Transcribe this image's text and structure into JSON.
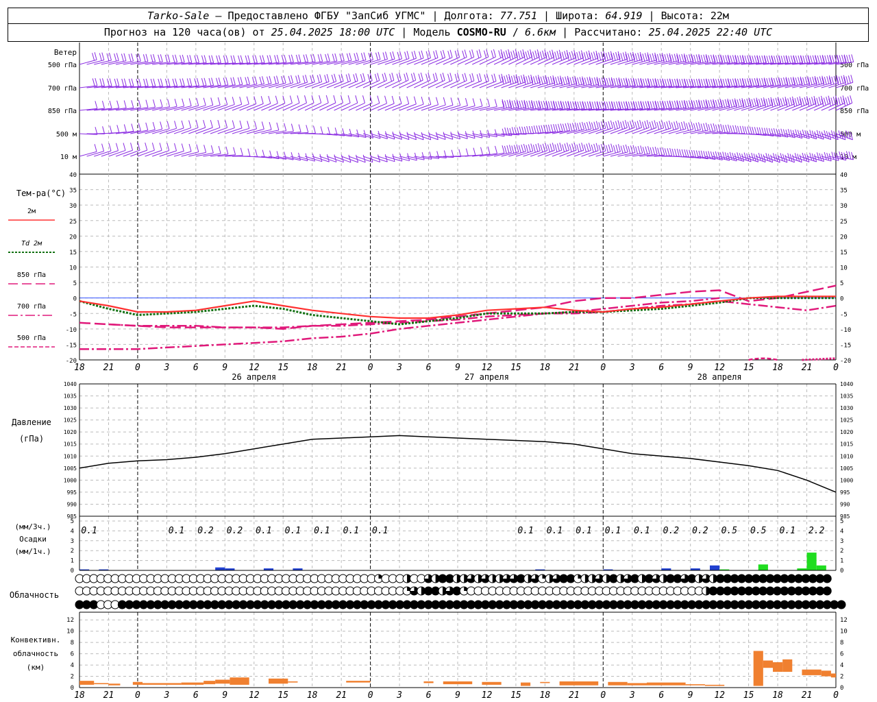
{
  "header": {
    "station": "Tarko-Sale",
    "provider": "Предоставлено ФГБУ \"ЗапСиб УГМС\"",
    "lon_label": "Долгота:",
    "lon": "77.751",
    "lat_label": "Широта:",
    "lat": "64.919",
    "alt_label": "Высота:",
    "alt": "22м",
    "forecast_label": "Прогноз на 120 часа(ов) от",
    "forecast_start": "25.04.2025 18:00 UTC",
    "model_label": "Модель",
    "model": "COSMO-RU",
    "resolution": "6.6км",
    "calc_label": "Рассчитано:",
    "calc_time": "25.04.2025 22:40 UTC"
  },
  "wind_panel": {
    "title": "Ветер",
    "levels": [
      "500 гПа",
      "700 гПа",
      "850 гПа",
      "500 м",
      "10 м"
    ],
    "color": "#8a2be2"
  },
  "temp_panel": {
    "title": "Тем-ра(°C)",
    "ylim": [
      -20,
      40
    ],
    "legend": [
      {
        "label": "2м",
        "color": "#ff3030",
        "style": "solid"
      },
      {
        "label": "Td 2м",
        "color": "#107010",
        "style": "dotted"
      },
      {
        "label": "850 гПа",
        "color": "#e0197a",
        "style": "longdash"
      },
      {
        "label": "700 гПа",
        "color": "#e0197a",
        "style": "dashdot"
      },
      {
        "label": "500 гПа",
        "color": "#e0197a",
        "style": "dashed"
      }
    ]
  },
  "pressure_panel": {
    "title": "Давление",
    "unit": "(гПа)",
    "ylim": [
      985,
      1040
    ]
  },
  "precip_panel": {
    "title_top": "(мм/3ч.)",
    "title": "Осадки",
    "unit": "(мм/1ч.)",
    "ylim": [
      0,
      5
    ]
  },
  "cloud_panel": {
    "title": "Облачность"
  },
  "conv_panel": {
    "title_1": "Конвективн.",
    "title_2": "облачность",
    "unit": "(км)",
    "ylim": [
      0,
      13
    ]
  },
  "time_axis": {
    "tick_labels": [
      "18",
      "21",
      "0",
      "3",
      "6",
      "9",
      "12",
      "15",
      "18",
      "21",
      "0",
      "3",
      "6",
      "9",
      "12",
      "15",
      "18",
      "21",
      "0",
      "3",
      "6",
      "9",
      "12",
      "15",
      "18",
      "21",
      "0"
    ],
    "date_labels": [
      "26 апреля",
      "27 апреля",
      "28 апреля"
    ]
  },
  "chart_data": {
    "type": "line",
    "x_hours": [
      0,
      3,
      6,
      9,
      12,
      15,
      18,
      21,
      24,
      27,
      30,
      33,
      36,
      39,
      42,
      45,
      48,
      51,
      54,
      57,
      60,
      63,
      66,
      69,
      72,
      75,
      78
    ],
    "t2m": [
      -1,
      -2.5,
      -4.5,
      -4.5,
      -4,
      -2.5,
      -1,
      -2.5,
      -4,
      -5,
      -6,
      -6.5,
      -6.5,
      -5.5,
      -4,
      -3.5,
      -3,
      -4,
      -4.5,
      -3.5,
      -3,
      -2,
      -1,
      0,
      0.5,
      0.5,
      0.5
    ],
    "td2m": [
      -1,
      -3.5,
      -5.5,
      -5,
      -4.5,
      -3.5,
      -2.5,
      -3.5,
      -5.5,
      -6.5,
      -7.5,
      -8.5,
      -7.5,
      -6.5,
      -5,
      -5,
      -5,
      -4.5,
      -4.5,
      -4,
      -3.5,
      -2.5,
      -1.5,
      0,
      0,
      0,
      0
    ],
    "t850": [
      -8,
      -8.5,
      -9,
      -9.5,
      -9.5,
      -9.5,
      -9.5,
      -10,
      -9,
      -8.5,
      -8,
      -7.5,
      -7,
      -6,
      -5,
      -4,
      -3,
      -1,
      0,
      0,
      1,
      2,
      2.5,
      -1,
      0,
      2,
      4
    ],
    "t700": [
      -1,
      -8.5,
      -9,
      -9,
      -9,
      -9.5,
      -9.5,
      -9.5,
      -9,
      -9,
      -8.5,
      -8,
      -7.5,
      -7,
      -6,
      -5.5,
      -5,
      -5,
      -4.5,
      -3.5,
      -2.5,
      -2,
      -1,
      -2,
      -3,
      -4,
      -2.5
    ],
    "t500": [
      -16.5,
      -16.5,
      -16.5,
      -16,
      -15.5,
      -15,
      -14.5,
      -14,
      -13,
      -12.5,
      -11.5,
      -10,
      -9,
      -8,
      -7,
      -6,
      -5,
      -4.5,
      -3.5,
      -2.5,
      -1.5,
      -1,
      0,
      -21,
      -20,
      -21,
      -19
    ],
    "pressure": [
      1005,
      1007,
      1008,
      1008.5,
      1009.5,
      1011,
      1013,
      1015,
      1017,
      1017.5,
      1018,
      1018.5,
      1018,
      1017.5,
      1017,
      1016.5,
      1016,
      1015,
      1013,
      1011,
      1010,
      1009,
      1007.5,
      1006,
      1004,
      1000,
      995
    ],
    "precip_3h_labels": [
      {
        "hour": 1,
        "label": "0.1"
      },
      {
        "hour": 10,
        "label": "0.1"
      },
      {
        "hour": 13,
        "label": "0.2"
      },
      {
        "hour": 16,
        "label": "0.2"
      },
      {
        "hour": 19,
        "label": "0.1"
      },
      {
        "hour": 22,
        "label": "0.1"
      },
      {
        "hour": 25,
        "label": "0.1"
      },
      {
        "hour": 28,
        "label": "0.1"
      },
      {
        "hour": 31,
        "label": "0.1"
      },
      {
        "hour": 46,
        "label": "0.1"
      },
      {
        "hour": 49,
        "label": "0.1"
      },
      {
        "hour": 52,
        "label": "0.1"
      },
      {
        "hour": 55,
        "label": "0.1"
      },
      {
        "hour": 58,
        "label": "0.1"
      },
      {
        "hour": 61,
        "label": "0.2"
      },
      {
        "hour": 64,
        "label": "0.2"
      },
      {
        "hour": 67,
        "label": "0.5"
      },
      {
        "hour": 70,
        "label": "0.5"
      },
      {
        "hour": 73,
        "label": "0.1"
      },
      {
        "hour": 76,
        "label": "2.2"
      }
    ],
    "precip_1h": [
      {
        "hour": 0,
        "value": 0.1,
        "color": "#2040d0"
      },
      {
        "hour": 2,
        "value": 0.1,
        "color": "#2040d0"
      },
      {
        "hour": 14,
        "value": 0.3,
        "color": "#2040d0"
      },
      {
        "hour": 15,
        "value": 0.2,
        "color": "#2040d0"
      },
      {
        "hour": 19,
        "value": 0.2,
        "color": "#2040d0"
      },
      {
        "hour": 22,
        "value": 0.2,
        "color": "#2040d0"
      },
      {
        "hour": 47,
        "value": 0.1,
        "color": "#2040d0"
      },
      {
        "hour": 54,
        "value": 0.1,
        "color": "#2040d0"
      },
      {
        "hour": 60,
        "value": 0.2,
        "color": "#2040d0"
      },
      {
        "hour": 63,
        "value": 0.2,
        "color": "#2040d0"
      },
      {
        "hour": 65,
        "value": 0.5,
        "color": "#2040d0"
      },
      {
        "hour": 66,
        "value": 0.1,
        "color": "#20dd20"
      },
      {
        "hour": 70,
        "value": 0.6,
        "color": "#20dd20"
      },
      {
        "hour": 74,
        "value": 0.2,
        "color": "#20dd20"
      },
      {
        "hour": 75,
        "value": 1.8,
        "color": "#20dd20"
      },
      {
        "hour": 76,
        "value": 0.5,
        "color": "#20dd20"
      }
    ],
    "cloud_high": [
      0,
      0,
      0,
      0,
      0,
      0,
      0,
      0,
      0,
      0,
      0,
      0,
      0,
      0,
      0,
      0,
      0,
      0,
      0,
      0,
      0,
      0,
      0,
      0,
      0,
      0,
      0,
      0,
      0,
      0,
      0,
      0,
      0,
      0,
      0,
      0,
      0,
      0,
      0,
      0,
      0,
      0,
      0.25,
      0,
      0,
      0,
      0.5,
      0,
      0,
      0.75,
      0.5,
      1,
      1,
      0.5,
      0.5,
      0.75,
      0.5,
      0.75,
      0.5,
      0.5,
      0.75,
      0.75,
      1,
      0.5,
      0.75,
      0.25,
      0.5,
      0.75,
      1,
      1,
      0.25,
      0.5,
      0.5,
      0.75,
      0.5,
      1,
      0.5,
      0.75,
      1,
      0.5,
      1,
      0.75,
      0.5,
      1,
      1,
      0.75,
      1,
      0.5,
      0.75,
      0.5,
      1,
      1,
      1,
      1,
      1,
      1,
      1,
      1,
      1,
      1,
      1,
      1,
      1,
      1,
      1,
      1
    ],
    "cloud_mid": [
      0,
      0,
      0,
      0,
      0,
      0,
      0,
      0,
      0,
      0,
      0,
      0,
      0,
      0,
      0,
      0,
      0,
      0,
      0,
      0,
      0,
      0,
      0,
      0,
      0,
      0,
      0,
      0,
      0,
      0,
      0,
      0,
      0,
      0,
      0,
      0,
      0,
      0,
      0,
      0,
      0,
      0,
      0,
      0,
      0,
      0,
      0.25,
      0.75,
      0.5,
      1,
      1,
      0.5,
      0.75,
      1,
      0.25,
      0,
      0,
      0,
      0,
      0,
      0,
      0,
      0,
      0,
      0,
      0,
      0,
      0,
      0,
      0,
      0,
      0,
      0,
      0,
      0,
      0,
      0,
      0,
      0,
      0,
      0,
      0,
      0,
      0,
      0,
      0,
      0,
      0,
      0.5,
      1,
      1,
      1,
      1,
      1,
      1,
      1,
      1,
      1,
      1,
      1,
      1,
      1,
      1,
      1,
      1,
      1
    ],
    "cloud_low": [
      1,
      1,
      1,
      0,
      0,
      0,
      1,
      1,
      1,
      1,
      1,
      1,
      1,
      1,
      1,
      1,
      1,
      1,
      1,
      1,
      1,
      1,
      1,
      1,
      1,
      1,
      1,
      1,
      1,
      1,
      1,
      1,
      1,
      1,
      1,
      1,
      1,
      1,
      1,
      1,
      1,
      1,
      1,
      1,
      1,
      1,
      1,
      1,
      1,
      1,
      1,
      1,
      1,
      1,
      1,
      1,
      1,
      1,
      1,
      1,
      1,
      1,
      1,
      1,
      1,
      1,
      1,
      1,
      1,
      1,
      1,
      1,
      1,
      1,
      1,
      1,
      1,
      1,
      1,
      1,
      1,
      1,
      1,
      1,
      1,
      1,
      1,
      1,
      1,
      1,
      1,
      1,
      1,
      1,
      1,
      1,
      1,
      1,
      1,
      1,
      1,
      1,
      1,
      1,
      1,
      1,
      1,
      1
    ],
    "conv_cloud": [
      {
        "h0": 0,
        "h1": 1.5,
        "low": 0.5,
        "high": 1.2
      },
      {
        "h0": 1.5,
        "h1": 3,
        "low": 0.6,
        "high": 0.8
      },
      {
        "h0": 3,
        "h1": 4.2,
        "low": 0.4,
        "high": 0.7
      },
      {
        "h0": 5.5,
        "h1": 6.5,
        "low": 0.5,
        "high": 1.0
      },
      {
        "h0": 6.5,
        "h1": 10.5,
        "low": 0.5,
        "high": 0.8
      },
      {
        "h0": 10.5,
        "h1": 12.8,
        "low": 0.5,
        "high": 0.9
      },
      {
        "h0": 12.8,
        "h1": 14,
        "low": 0.6,
        "high": 1.2
      },
      {
        "h0": 14,
        "h1": 15.5,
        "low": 0.7,
        "high": 1.4
      },
      {
        "h0": 15.5,
        "h1": 17.5,
        "low": 0.5,
        "high": 1.8
      },
      {
        "h0": 19.5,
        "h1": 21.5,
        "low": 0.7,
        "high": 1.6
      },
      {
        "h0": 21.5,
        "h1": 22.5,
        "low": 0.9,
        "high": 1.1
      },
      {
        "h0": 27.5,
        "h1": 30,
        "low": 0.9,
        "high": 1.2
      },
      {
        "h0": 35.5,
        "h1": 36.5,
        "low": 0.8,
        "high": 1.1
      },
      {
        "h0": 37.5,
        "h1": 40.5,
        "low": 0.6,
        "high": 1.1
      },
      {
        "h0": 41.5,
        "h1": 43.5,
        "low": 0.5,
        "high": 1.0
      },
      {
        "h0": 45.5,
        "h1": 46.5,
        "low": 0.3,
        "high": 0.9
      },
      {
        "h0": 47.5,
        "h1": 48.5,
        "low": 0.8,
        "high": 1.0
      },
      {
        "h0": 49.5,
        "h1": 53.5,
        "low": 0.4,
        "high": 1.1
      },
      {
        "h0": 54.5,
        "h1": 56.5,
        "low": 0.4,
        "high": 1.0
      },
      {
        "h0": 56.5,
        "h1": 58.5,
        "low": 0.4,
        "high": 0.8
      },
      {
        "h0": 58.5,
        "h1": 62.5,
        "low": 0.4,
        "high": 0.9
      },
      {
        "h0": 62.5,
        "h1": 64.5,
        "low": 0.4,
        "high": 0.6
      },
      {
        "h0": 64.5,
        "h1": 66.5,
        "low": 0.3,
        "high": 0.5
      },
      {
        "h0": 69.5,
        "h1": 70.5,
        "low": 0.3,
        "high": 6.5
      },
      {
        "h0": 70.5,
        "h1": 71.5,
        "low": 3.5,
        "high": 4.8
      },
      {
        "h0": 71.5,
        "h1": 72.5,
        "low": 2.8,
        "high": 4.5
      },
      {
        "h0": 72.5,
        "h1": 73.5,
        "low": 2.8,
        "high": 5.0
      },
      {
        "h0": 74.5,
        "h1": 76.5,
        "low": 2.2,
        "high": 3.2
      },
      {
        "h0": 76.5,
        "h1": 77.5,
        "low": 2.0,
        "high": 3.0
      },
      {
        "h0": 77.5,
        "h1": 78,
        "low": 1.8,
        "high": 2.5
      }
    ]
  }
}
